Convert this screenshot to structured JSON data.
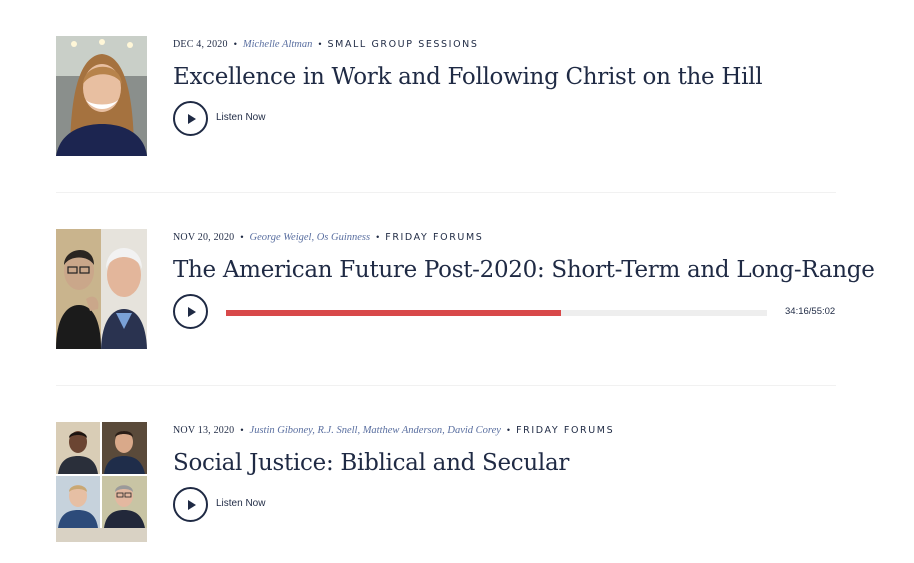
{
  "episodes": [
    {
      "date": "DEC 4, 2020",
      "speakers": "Michelle Altman",
      "category": "SMALL GROUP SESSIONS",
      "title": "Excellence in Work and Following Christ on the Hill",
      "action_label": "Listen Now"
    },
    {
      "date": "NOV 20, 2020",
      "speakers": "George Weigel, Os Guinness",
      "category": "FRIDAY FORUMS",
      "title": "The American Future Post-2020: Short-Term and Long-Range",
      "progress_fraction": 0.62,
      "time": "34:16/55:02"
    },
    {
      "date": "NOV 13, 2020",
      "speakers": "Justin Giboney, R.J. Snell, Matthew Anderson, David Corey",
      "category": "FRIDAY FORUMS",
      "title": "Social Justice: Biblical and Secular",
      "action_label": "Listen Now"
    }
  ],
  "colors": {
    "text": "#1f2a44",
    "speaker_link": "#5a6fa0",
    "progress": "#d8494a",
    "track": "#eeeeee"
  },
  "icons": {
    "play": "play-icon"
  }
}
